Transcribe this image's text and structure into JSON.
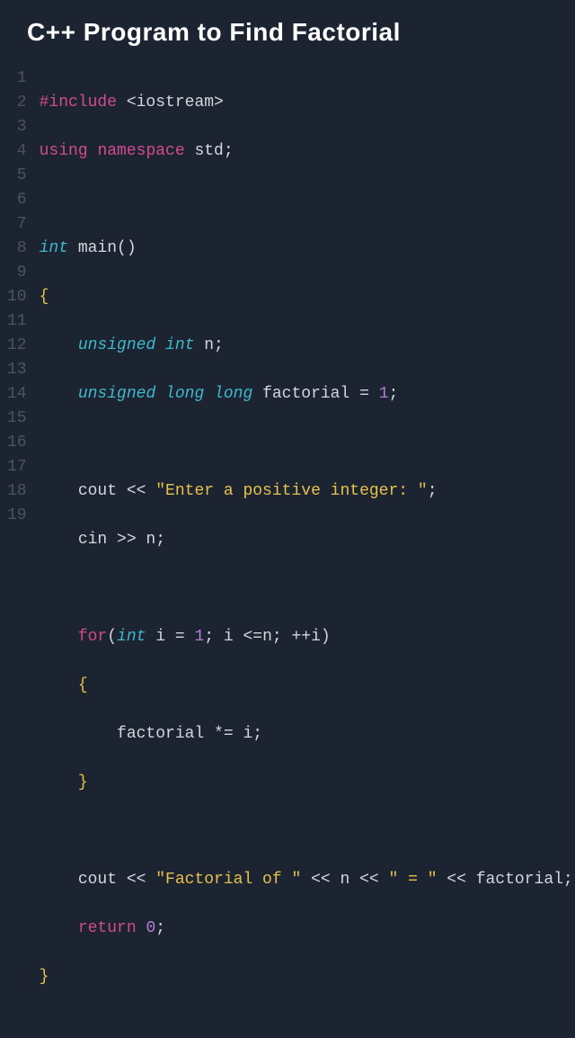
{
  "title": "C++ Program to Find Factorial",
  "gutter": [
    "1",
    "2",
    "3",
    "4",
    "5",
    "6",
    "7",
    "8",
    "9",
    "10",
    "11",
    "12",
    "13",
    "14",
    "15",
    "16",
    "17",
    "18",
    "19"
  ],
  "code": {
    "l1": {
      "a": "#include",
      "b": " <iostream>"
    },
    "l2": {
      "a": "using",
      "b": " ",
      "c": "namespace",
      "d": " std;"
    },
    "l4": {
      "a": "int",
      "b": " main()"
    },
    "l5": "{",
    "l6": {
      "a": "    ",
      "b": "unsigned int",
      "c": " n;"
    },
    "l7": {
      "a": "    ",
      "b": "unsigned long long",
      "c": " factorial = ",
      "d": "1",
      "e": ";"
    },
    "l9": {
      "a": "    cout << ",
      "b": "\"Enter a positive integer: \"",
      "c": ";"
    },
    "l10": "    cin >> n;",
    "l12": {
      "a": "    ",
      "b": "for",
      "c": "(",
      "d": "int",
      "e": " i = ",
      "f": "1",
      "g": "; i <=n; ++i)"
    },
    "l13": {
      "a": "    ",
      "b": "{"
    },
    "l14": "        factorial *= i;",
    "l15": {
      "a": "    ",
      "b": "}"
    },
    "l17": {
      "a": "    cout << ",
      "b": "\"Factorial of \"",
      "c": " << n << ",
      "d": "\" = \"",
      "e": " << factorial;"
    },
    "l18": {
      "a": "    ",
      "b": "return",
      "c": " ",
      "d": "0",
      "e": ";"
    },
    "l19": "}"
  }
}
